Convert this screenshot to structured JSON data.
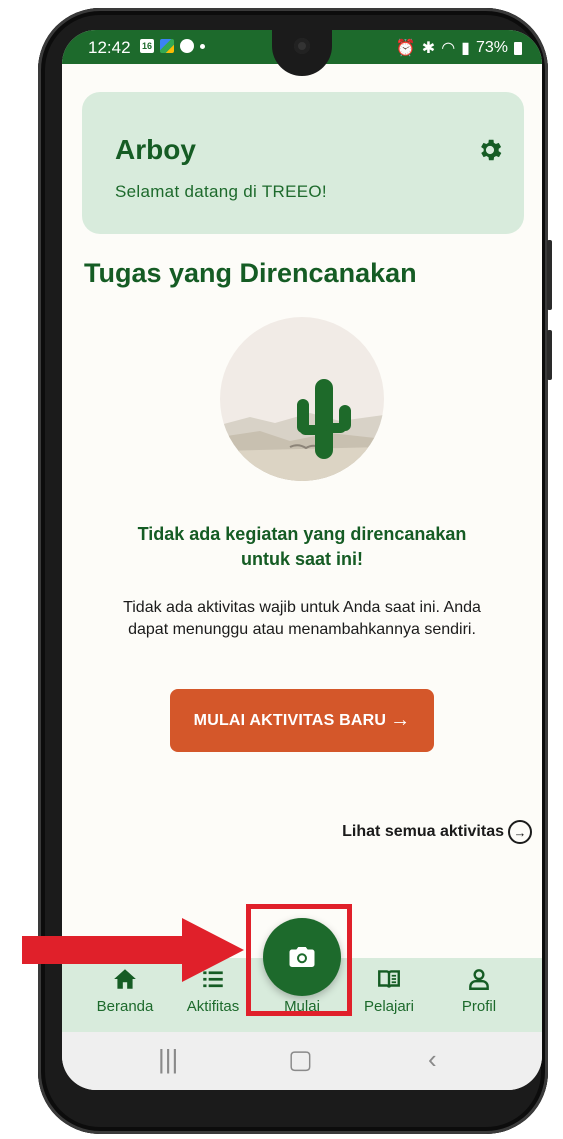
{
  "status_bar": {
    "time": "12:42",
    "badge": "16",
    "battery": "73%"
  },
  "welcome_card": {
    "user_name": "Arboy",
    "greeting": "Selamat datang di TREEO!",
    "settings_icon": "gear-icon"
  },
  "section_title": "Tugas yang Direncanakan",
  "empty_state": {
    "title": "Tidak ada kegiatan yang direncanakan untuk saat ini!",
    "description": "Tidak ada aktivitas wajib untuk Anda saat ini. Anda dapat menunggu atau menambahkannya sendiri."
  },
  "start_button_label": "MULAI AKTIVITAS BARU",
  "see_all_label": "Lihat semua aktivitas",
  "bottom_nav": {
    "items": [
      {
        "label": "Beranda",
        "icon": "home-icon"
      },
      {
        "label": "Aktifitas",
        "icon": "list-icon"
      },
      {
        "label": "Mulai",
        "icon": "camera-icon"
      },
      {
        "label": "Pelajari",
        "icon": "book-icon"
      },
      {
        "label": "Profil",
        "icon": "person-icon"
      }
    ]
  },
  "colors": {
    "primary_green": "#1d6a2c",
    "card_background": "#d8ebdc",
    "accent_orange": "#d4572a",
    "highlight_red": "#e0202a"
  }
}
